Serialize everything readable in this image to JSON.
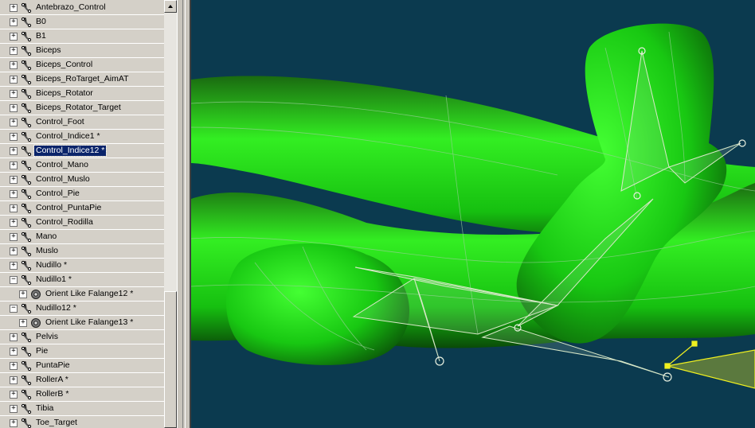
{
  "outliner": {
    "items": [
      {
        "label": "Antebrazo_Control",
        "expander": "+",
        "level": 0,
        "icon": "bone-node-icon"
      },
      {
        "label": "B0",
        "expander": "+",
        "level": 0,
        "icon": "bone-node-icon"
      },
      {
        "label": "B1",
        "expander": "+",
        "level": 0,
        "icon": "bone-node-icon"
      },
      {
        "label": "Biceps",
        "expander": "+",
        "level": 0,
        "icon": "bone-node-icon"
      },
      {
        "label": "Biceps_Control",
        "expander": "+",
        "level": 0,
        "icon": "bone-node-icon"
      },
      {
        "label": "Biceps_RoTarget_AimAT",
        "expander": "+",
        "level": 0,
        "icon": "bone-node-icon"
      },
      {
        "label": "Biceps_Rotator",
        "expander": "+",
        "level": 0,
        "icon": "bone-node-icon"
      },
      {
        "label": "Biceps_Rotator_Target",
        "expander": "+",
        "level": 0,
        "icon": "bone-node-icon"
      },
      {
        "label": "Control_Foot",
        "expander": "+",
        "level": 0,
        "icon": "bone-node-icon"
      },
      {
        "label": "Control_Indice1 *",
        "expander": "+",
        "level": 0,
        "icon": "bone-node-icon"
      },
      {
        "label": "Control_Indice12 *",
        "expander": "+",
        "level": 0,
        "icon": "bone-node-icon",
        "selected": true
      },
      {
        "label": "Control_Mano",
        "expander": "+",
        "level": 0,
        "icon": "bone-node-icon"
      },
      {
        "label": "Control_Muslo",
        "expander": "+",
        "level": 0,
        "icon": "bone-node-icon"
      },
      {
        "label": "Control_Pie",
        "expander": "+",
        "level": 0,
        "icon": "bone-node-icon"
      },
      {
        "label": "Control_PuntaPie",
        "expander": "+",
        "level": 0,
        "icon": "bone-node-icon"
      },
      {
        "label": "Control_Rodilla",
        "expander": "+",
        "level": 0,
        "icon": "bone-node-icon"
      },
      {
        "label": "Mano",
        "expander": "+",
        "level": 0,
        "icon": "bone-node-icon"
      },
      {
        "label": "Muslo",
        "expander": "+",
        "level": 0,
        "icon": "bone-node-icon"
      },
      {
        "label": "Nudillo *",
        "expander": "+",
        "level": 0,
        "icon": "bone-node-icon"
      },
      {
        "label": "Nudillo1 *",
        "expander": "−",
        "level": 0,
        "icon": "bone-node-icon"
      },
      {
        "label": "Orient Like Falange12 *",
        "expander": "+",
        "level": 1,
        "icon": "gear-icon"
      },
      {
        "label": "Nudillo12 *",
        "expander": "−",
        "level": 0,
        "icon": "bone-node-icon"
      },
      {
        "label": "Orient Like Falange13 *",
        "expander": "+",
        "level": 1,
        "icon": "gear-icon"
      },
      {
        "label": "Pelvis",
        "expander": "+",
        "level": 0,
        "icon": "bone-node-icon"
      },
      {
        "label": "Pie",
        "expander": "+",
        "level": 0,
        "icon": "bone-node-icon"
      },
      {
        "label": "PuntaPie",
        "expander": "+",
        "level": 0,
        "icon": "bone-node-icon"
      },
      {
        "label": "RollerA *",
        "expander": "+",
        "level": 0,
        "icon": "bone-node-icon"
      },
      {
        "label": "RollerB *",
        "expander": "+",
        "level": 0,
        "icon": "bone-node-icon"
      },
      {
        "label": "Tibia",
        "expander": "+",
        "level": 0,
        "icon": "bone-node-icon"
      },
      {
        "label": "Toe_Target",
        "expander": "+",
        "level": 0,
        "icon": "bone-node-icon"
      }
    ]
  },
  "scrollbar": {
    "up_arrow": "▲"
  },
  "viewport": {
    "background": "#0b3a4f",
    "mesh_color": "#00dd00",
    "bone_color": "#e0e8c0",
    "selected_color": "#f0f020"
  },
  "colors": {
    "panel": "#d4d0c8",
    "selection": "#0a246a"
  }
}
